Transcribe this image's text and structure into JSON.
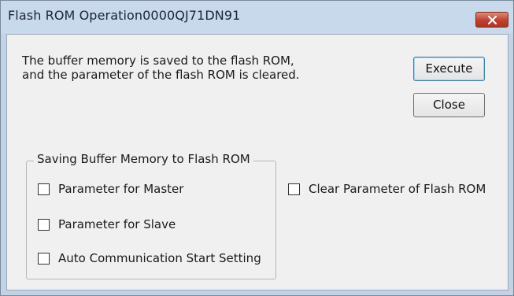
{
  "window": {
    "title": "Flash ROM Operation0000QJ71DN91",
    "close_icon": "close-x-icon"
  },
  "description": {
    "line1": "The buffer memory is saved to the flash ROM,",
    "line2": "and the parameter of the flash ROM is cleared."
  },
  "buttons": {
    "execute": "Execute",
    "close": "Close"
  },
  "group": {
    "title": "Saving Buffer Memory to Flash ROM",
    "items": [
      {
        "label": "Parameter for Master",
        "checked": false
      },
      {
        "label": "Parameter for Slave",
        "checked": false
      },
      {
        "label": "Auto Communication Start Setting",
        "checked": false
      }
    ]
  },
  "clear_param": {
    "label": "Clear Parameter of Flash ROM",
    "checked": false
  },
  "colors": {
    "titlebar": "#c9d9ec",
    "client": "#f0f0f0",
    "close_button": "#c0402e"
  }
}
